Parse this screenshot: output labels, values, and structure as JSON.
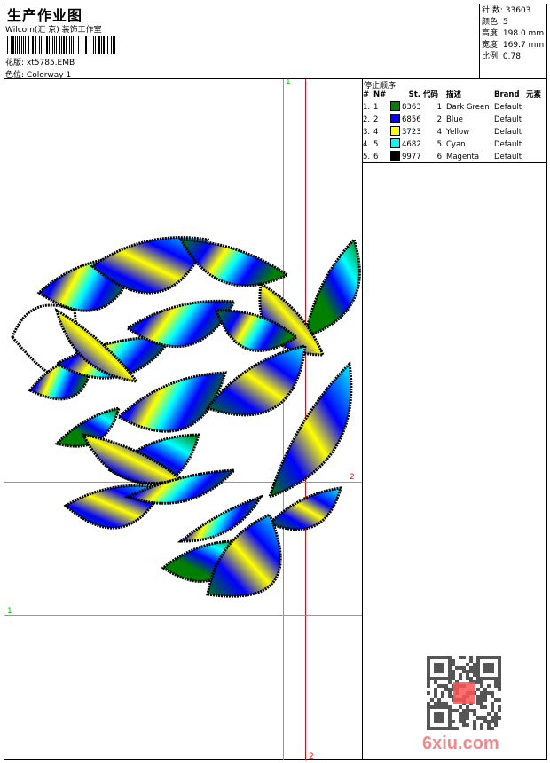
{
  "header": {
    "title": "生产作业图",
    "subtitle": "Wilcom(汇 京) 装饰工作室",
    "design_label": "花版:",
    "design_value": "xt5785.EMB",
    "colorway_label": "色位:",
    "colorway_value": "Colorway 1"
  },
  "stats": [
    {
      "label": "针 数:",
      "value": "33603"
    },
    {
      "label": "颜色:",
      "value": "5"
    },
    {
      "label": "高度:",
      "value": "198.0 mm"
    },
    {
      "label": "宽度:",
      "value": "169.7 mm"
    },
    {
      "label": "比例:",
      "value": "0.78"
    }
  ],
  "stop_sequence": {
    "title": "停止顺序:",
    "columns": [
      "#",
      "N#",
      "St.",
      "代码",
      "描述",
      "Brand",
      "元素"
    ],
    "rows": [
      {
        "index": "1.",
        "n": "1",
        "color": "#008000",
        "st": "8363",
        "code": "1",
        "desc": "Dark Green",
        "brand": "Default"
      },
      {
        "index": "2.",
        "n": "2",
        "color": "#0000ff",
        "st": "6856",
        "code": "2",
        "desc": "Blue",
        "brand": "Default"
      },
      {
        "index": "3.",
        "n": "4",
        "color": "#ffff00",
        "st": "3723",
        "code": "4",
        "desc": "Yellow",
        "brand": "Default"
      },
      {
        "index": "4.",
        "n": "5",
        "color": "#00ffff",
        "st": "4682",
        "code": "5",
        "desc": "Cyan",
        "brand": "Default"
      },
      {
        "index": "5.",
        "n": "6",
        "color": "#000000",
        "st": "9977",
        "code": "6",
        "desc": "Magenta",
        "brand": "Default"
      }
    ]
  },
  "guides": {
    "green_top_label": "1",
    "green_left_label": "1",
    "red_right_label": "2",
    "red_bottom_label": "2",
    "green_color": "#00ff00",
    "red_color": "#ff0000"
  },
  "watermark": {
    "text": "6xiu.com",
    "seal": "以图版"
  }
}
